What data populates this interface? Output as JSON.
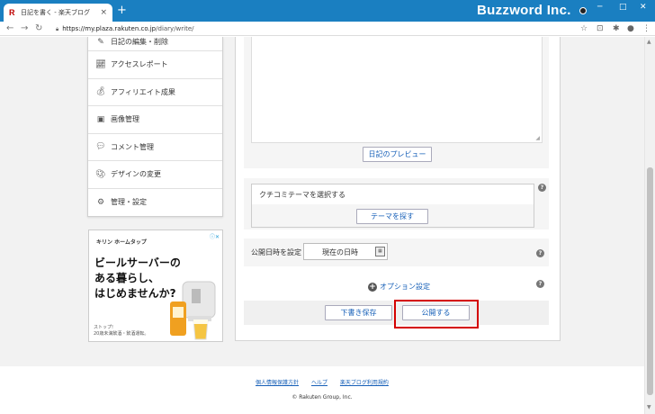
{
  "browser": {
    "tab_title": "日記を書く - 楽天ブログ",
    "tab_close": "×",
    "new_tab": "+",
    "brand": "Buzzword Inc.",
    "url_host": "https://my.plaza.rakuten.co.jp",
    "url_path": "/diary/write/",
    "win_min": "─",
    "win_max": "□",
    "win_close": "✕"
  },
  "sidebar": {
    "items": [
      {
        "label": "日記の編集・削除",
        "icon": "edit-icon"
      },
      {
        "label": "アクセスレポート",
        "icon": "chart-icon"
      },
      {
        "label": "アフィリエイト成果",
        "icon": "money-bag-icon"
      },
      {
        "label": "画像管理",
        "icon": "image-icon"
      },
      {
        "label": "コメント管理",
        "icon": "comment-icon"
      },
      {
        "label": "デザインの変更",
        "icon": "palette-icon"
      },
      {
        "label": "管理・設定",
        "icon": "gear-icon"
      }
    ]
  },
  "ad": {
    "brand": "キリン ホームタップ",
    "line1": "ビールサーバーの",
    "line2": "ある暮らし、",
    "line3": "はじめませんか?",
    "small1": "ストップ!",
    "small2": "20歳未満飲酒・飲酒運転。"
  },
  "editor": {
    "preview_button": "日記のプレビュー"
  },
  "theme": {
    "label": "クチコミテーマを選択する",
    "search_button": "テーマを探す"
  },
  "publish_date": {
    "label": "公開日時を設定",
    "value": "現在の日時"
  },
  "options": {
    "link": "オプション設定"
  },
  "actions": {
    "draft_button": "下書き保存",
    "publish_button": "公開する"
  },
  "footer": {
    "links": [
      "個人情報保護方針",
      "ヘルプ",
      "楽天ブログ利用規約"
    ],
    "copyright": "© Rakuten Group, Inc."
  },
  "colors": {
    "titlebar": "#1a7fc1",
    "link": "#1760b8",
    "highlight": "#d40000"
  }
}
